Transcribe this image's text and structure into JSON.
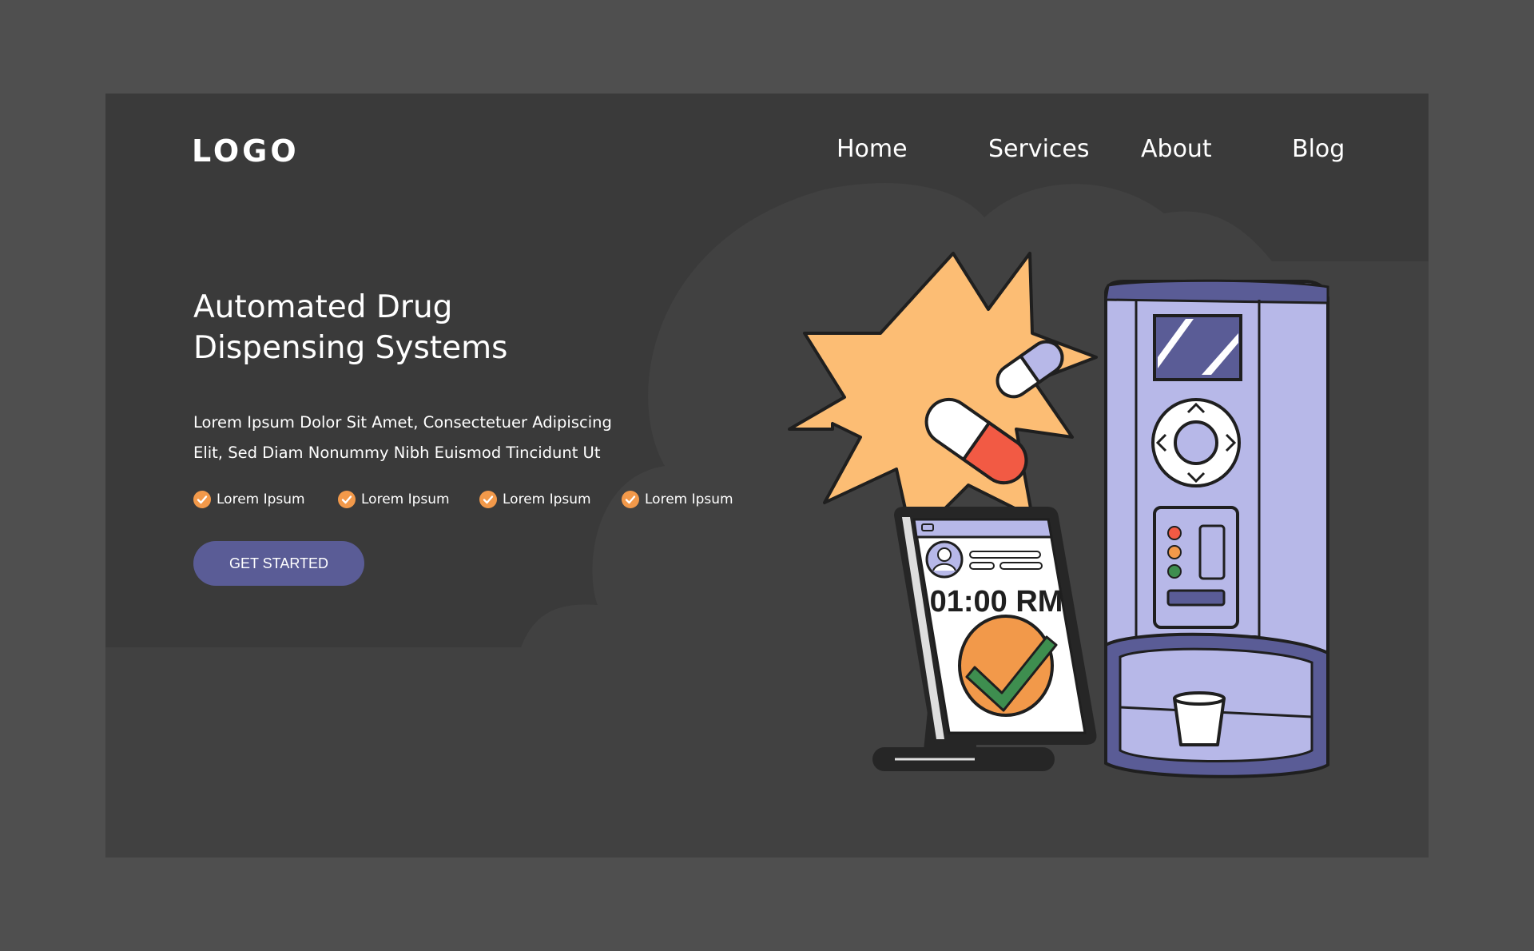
{
  "header": {
    "logo": "LOGO",
    "nav": [
      {
        "label": "Home"
      },
      {
        "label": "Services"
      },
      {
        "label": "About"
      },
      {
        "label": "Blog"
      }
    ]
  },
  "hero": {
    "title_line1": "Automated Drug",
    "title_line2": "Dispensing Systems",
    "description_line1": "Lorem Ipsum Dolor Sit Amet, Consectetuer Adipiscing",
    "description_line2": "Elit, Sed Diam Nonummy Nibh Euismod Tincidunt Ut",
    "features": [
      {
        "label": "Lorem Ipsum"
      },
      {
        "label": "Lorem Ipsum"
      },
      {
        "label": "Lorem Ipsum"
      },
      {
        "label": "Lorem Ipsum"
      }
    ],
    "cta_label": "GET STARTED"
  },
  "illustration": {
    "phone_time": "01:00 RM"
  },
  "colors": {
    "page_bg": "#4f4f4f",
    "frame_bg": "#3a3a3a",
    "accent_purple": "#5a5c96",
    "machine_lavender": "#b7b8e8",
    "burst_orange": "#fcbd74",
    "check_orange": "#f2994a",
    "pill_red": "#f25a44",
    "check_green": "#3e8e4f"
  }
}
